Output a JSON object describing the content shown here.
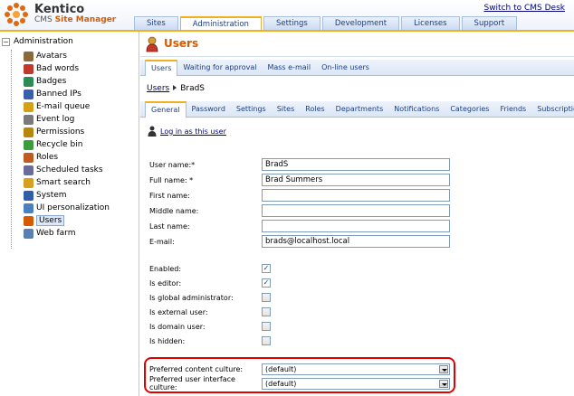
{
  "header": {
    "brand_name": "Kentico",
    "brand_product_a": "CMS",
    "brand_product_b": "Site Manager",
    "switch_link": "Switch to CMS Desk",
    "tabs": [
      {
        "label": "Sites",
        "active": false
      },
      {
        "label": "Administration",
        "active": true
      },
      {
        "label": "Settings",
        "active": false
      },
      {
        "label": "Development",
        "active": false
      },
      {
        "label": "Licenses",
        "active": false
      },
      {
        "label": "Support",
        "active": false
      }
    ]
  },
  "sidebar": {
    "root": {
      "label": "Administration",
      "toggle": "−"
    },
    "items": [
      {
        "label": "Avatars",
        "icon": "avatars-icon",
        "color": "#8a6a3a",
        "selected": false
      },
      {
        "label": "Bad words",
        "icon": "bad-words-icon",
        "color": "#c0392b",
        "selected": false
      },
      {
        "label": "Badges",
        "icon": "badges-icon",
        "color": "#2e8b57",
        "selected": false
      },
      {
        "label": "Banned IPs",
        "icon": "banned-ips-icon",
        "color": "#3a5fb0",
        "selected": false
      },
      {
        "label": "E-mail queue",
        "icon": "email-queue-icon",
        "color": "#d4a017",
        "selected": false
      },
      {
        "label": "Event log",
        "icon": "event-log-icon",
        "color": "#7a7a7a",
        "selected": false
      },
      {
        "label": "Permissions",
        "icon": "permissions-icon",
        "color": "#b8860b",
        "selected": false
      },
      {
        "label": "Recycle bin",
        "icon": "recycle-bin-icon",
        "color": "#3c9b3c",
        "selected": false
      },
      {
        "label": "Roles",
        "icon": "roles-icon",
        "color": "#c05a20",
        "selected": false
      },
      {
        "label": "Scheduled tasks",
        "icon": "scheduled-tasks-icon",
        "color": "#6b6b9b",
        "selected": false
      },
      {
        "label": "Smart search",
        "icon": "smart-search-icon",
        "color": "#d8a020",
        "selected": false
      },
      {
        "label": "System",
        "icon": "system-icon",
        "color": "#2f5fa8",
        "selected": false
      },
      {
        "label": "UI personalization",
        "icon": "ui-personalization-icon",
        "color": "#4a7fc0",
        "selected": false
      },
      {
        "label": "Users",
        "icon": "users-icon",
        "color": "#d75a00",
        "selected": true
      },
      {
        "label": "Web farm",
        "icon": "web-farm-icon",
        "color": "#5a7fb0",
        "selected": false
      }
    ]
  },
  "main": {
    "title": "Users",
    "top_tabs": [
      {
        "label": "Users",
        "active": true
      },
      {
        "label": "Waiting for approval",
        "active": false
      },
      {
        "label": "Mass e-mail",
        "active": false
      },
      {
        "label": "On-line users",
        "active": false
      }
    ],
    "breadcrumb": {
      "link": "Users",
      "current": "BradS"
    },
    "sub_tabs": [
      {
        "label": "General",
        "active": true
      },
      {
        "label": "Password",
        "active": false
      },
      {
        "label": "Settings",
        "active": false
      },
      {
        "label": "Sites",
        "active": false
      },
      {
        "label": "Roles",
        "active": false
      },
      {
        "label": "Departments",
        "active": false
      },
      {
        "label": "Notifications",
        "active": false
      },
      {
        "label": "Categories",
        "active": false
      },
      {
        "label": "Friends",
        "active": false
      },
      {
        "label": "Subscriptions",
        "active": false
      }
    ],
    "login_link": "Log in as this user",
    "fields": [
      {
        "label": "User name:*",
        "value": "BradS"
      },
      {
        "label": "Full name: *",
        "value": "Brad Summers"
      },
      {
        "label": "First name:",
        "value": ""
      },
      {
        "label": "Middle name:",
        "value": ""
      },
      {
        "label": "Last name:",
        "value": ""
      },
      {
        "label": "E-mail:",
        "value": "brads@localhost.local"
      }
    ],
    "checkboxes": [
      {
        "label": "Enabled:",
        "checked": true,
        "mark": "✓"
      },
      {
        "label": "Is editor:",
        "checked": true,
        "mark": "✓"
      },
      {
        "label": "Is global administrator:",
        "checked": false,
        "mark": ""
      },
      {
        "label": "Is external user:",
        "checked": false,
        "mark": ""
      },
      {
        "label": "Is domain user:",
        "checked": false,
        "mark": ""
      },
      {
        "label": "Is hidden:",
        "checked": false,
        "mark": ""
      }
    ],
    "cultures": [
      {
        "label": "Preferred content culture:",
        "value": "(default)"
      },
      {
        "label": "Preferred user interface culture:",
        "value": "(default)"
      }
    ]
  },
  "colors": {
    "accent": "#d75a00",
    "tab_highlight": "#f0b020",
    "link": "#000080",
    "highlight_box": "#e00000"
  }
}
